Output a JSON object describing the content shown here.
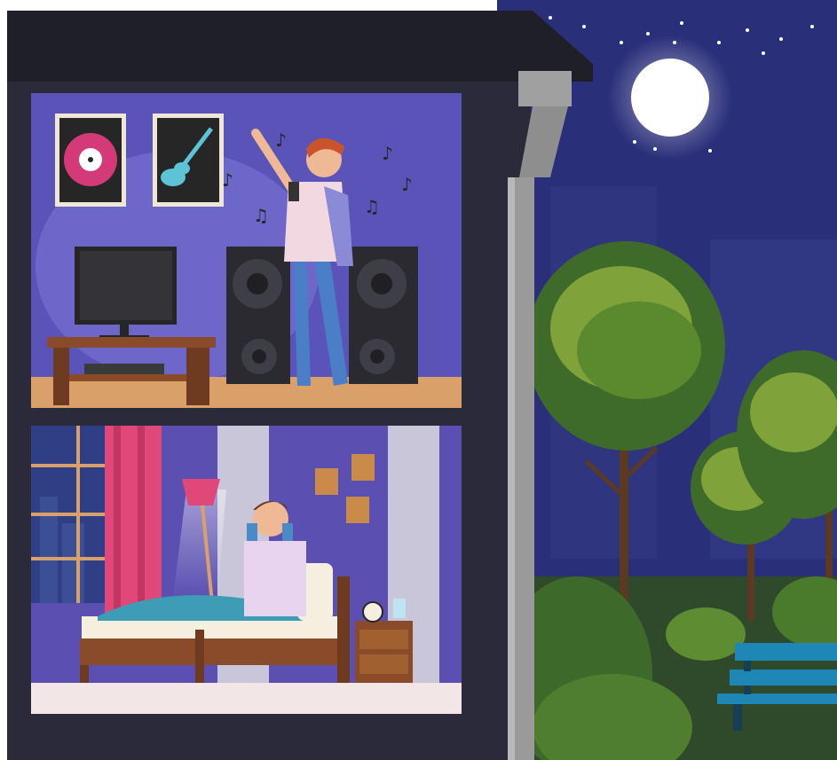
{
  "scene": {
    "description_tags": [
      "night",
      "house-cross-section",
      "upstairs-singer",
      "downstairs-sleeper",
      "park"
    ],
    "colors": {
      "night_sky": "#2a2f7a",
      "house_wall": "#2a2a3a",
      "roof": "#1f1f28",
      "upper_room_wall": "#5a54b8",
      "floor": "#d9a06a",
      "lower_room_wall": "#5b4fb2",
      "curtain": "#e0487a",
      "bed_wood": "#8a4b2a",
      "tree_dark": "#3f6b2a",
      "tree_light": "#7fa23a",
      "bench": "#1f87b6",
      "moon": "#ffffff"
    }
  }
}
